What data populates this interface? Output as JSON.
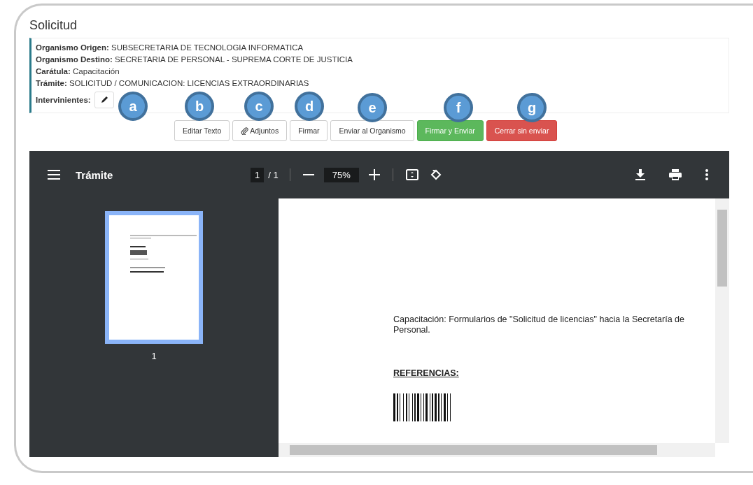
{
  "title": "Solicitud",
  "info": [
    "**Organismo Origen:** SUBSECRETARIA DE TECNOLOGIA INFORMATICA",
    "**Organismo Destino:** SECRETARIA DE PERSONAL - SUPREMA CORTE DE JUSTICIA",
    "**Carátula:** Capacitación",
    "**Trámite:** SOLICITUD / COMUNICACION: LICENCIAS EXTRAORDINARIAS"
  ],
  "intervinientes_label": "Intervinientes:",
  "buttons": [
    {
      "label": "Editar Texto",
      "kind": "default"
    },
    {
      "label": "Adjuntos",
      "kind": "attach"
    },
    {
      "label": "Firmar",
      "kind": "default"
    },
    {
      "label": "Enviar al Organismo",
      "kind": "default"
    },
    {
      "label": "Firmar y Enviar",
      "kind": "success"
    },
    {
      "label": "Cerrar sin enviar",
      "kind": "danger"
    }
  ],
  "callouts": [
    {
      "label": "a"
    },
    {
      "label": "b"
    },
    {
      "label": "c"
    },
    {
      "label": "d"
    },
    {
      "label": "e"
    },
    {
      "label": "f"
    },
    {
      "label": "g"
    }
  ],
  "viewer": {
    "title": "Trámite",
    "page": "1",
    "page_total": "/ 1",
    "zoom": "75%",
    "thumbnails": [
      {
        "label": "1",
        "selected": true
      }
    ],
    "document": {
      "paragraph": "Capacitación: Formularios de \"Solicitud de licencias\" hacia la Secretaría de Personal.",
      "heading": "REFERENCIAS:"
    }
  }
}
